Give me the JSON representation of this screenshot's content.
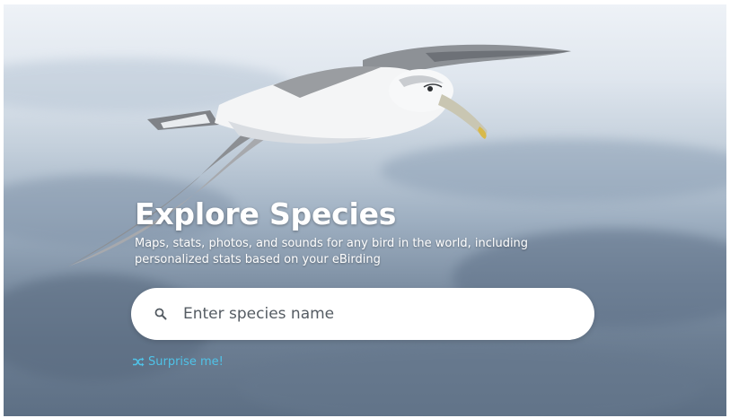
{
  "hero": {
    "title": "Explore Species",
    "subtitle": "Maps, stats, photos, and sounds for any bird in the world, including personalized stats based on your eBirding",
    "image_icon": "albatross-over-ocean-photo"
  },
  "search": {
    "placeholder": "Enter species name",
    "value": "",
    "icon": "search-icon"
  },
  "surprise": {
    "label": "Surprise me!",
    "icon": "shuffle-icon"
  },
  "colors": {
    "link": "#4fc3e8",
    "title": "#ffffff",
    "search_bg": "#ffffff",
    "placeholder": "#555c63"
  }
}
